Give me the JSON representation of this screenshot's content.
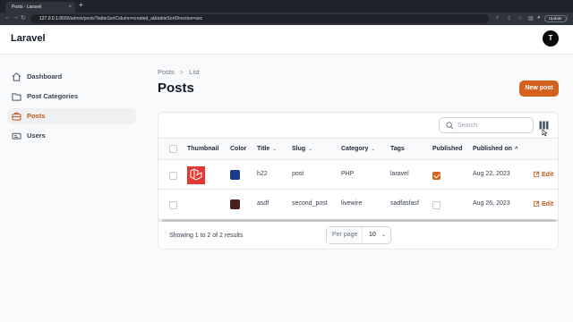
{
  "browser": {
    "tab_title": "Posts - Laravel",
    "tab_close": "×",
    "new_tab": "+",
    "url_host": "127.0.0.1",
    "url_rest": ":8000/admin/posts?tableSortColumn=created_at&tableSortDirection=asc",
    "update_label": "Update"
  },
  "header": {
    "brand": "Laravel",
    "avatar_initial": "T"
  },
  "sidebar": {
    "items": [
      {
        "label": "Dashboard",
        "icon": "home-icon",
        "active": false
      },
      {
        "label": "Post Categories",
        "icon": "folder-icon",
        "active": false
      },
      {
        "label": "Posts",
        "icon": "briefcase-icon",
        "active": true
      },
      {
        "label": "Users",
        "icon": "id-card-icon",
        "active": false
      }
    ]
  },
  "main": {
    "breadcrumb": [
      "Posts",
      "List"
    ],
    "breadcrumb_separator": ">",
    "title": "Posts",
    "new_button": "New post",
    "search_placeholder": "Search",
    "columns": {
      "thumbnail": "Thumbnail",
      "color": "Color",
      "title": "Title",
      "slug": "Slug",
      "category": "Category",
      "tags": "Tags",
      "published": "Published",
      "published_on": "Published on"
    },
    "sort_down_glyph": "⌄",
    "sort_up_glyph": "^",
    "rows": [
      {
        "thumbnail": "laravel-logo",
        "color": "#1e3a8a",
        "title": "h22",
        "slug": "post",
        "category": "PHP",
        "tags": "laravel",
        "published": true,
        "published_on": "Aug 22, 2023",
        "action": "Edit"
      },
      {
        "thumbnail": "",
        "color": "#4a1f1f",
        "title": "asdf",
        "slug": "second_post",
        "category": "livewire",
        "tags": "sadfasfasf",
        "published": false,
        "published_on": "Aug 26, 2023",
        "action": "Edit"
      }
    ],
    "footer": {
      "summary": "Showing 1 to 2 of 2 results",
      "per_page_label": "Per page",
      "per_page_value": "10",
      "per_page_chevron": "⌄"
    },
    "accent": "#d4621f"
  }
}
